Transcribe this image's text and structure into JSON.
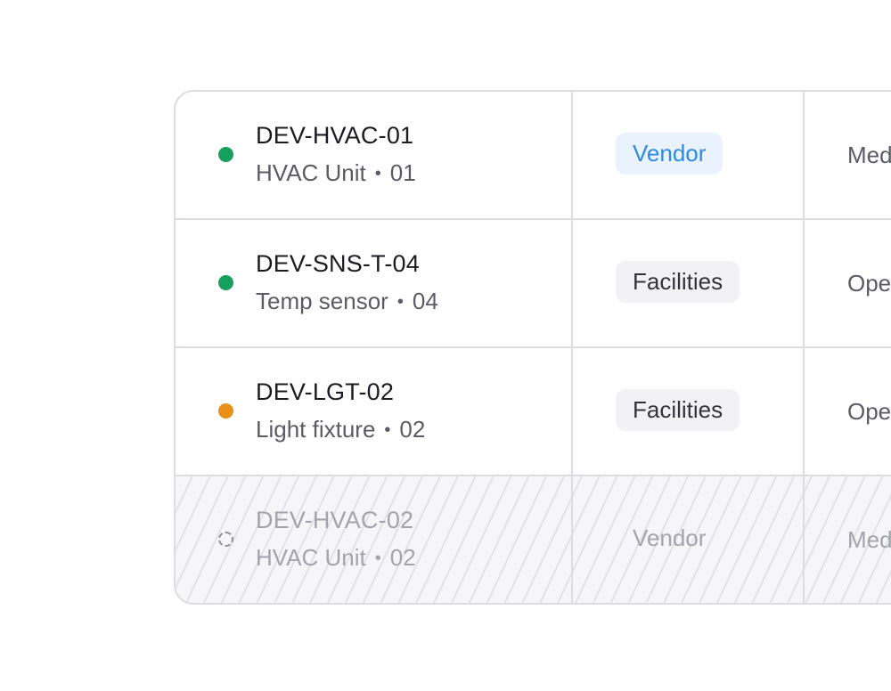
{
  "rows": [
    {
      "id": "DEV-HVAC-01",
      "type": "HVAC Unit",
      "number": "01",
      "status": "online",
      "team": "Vendor",
      "priority": "Medium"
    },
    {
      "id": "DEV-SNS-T-04",
      "type": "Temp sensor",
      "number": "04",
      "status": "online",
      "team": "Facilities",
      "priority": "Open"
    },
    {
      "id": "DEV-LGT-02",
      "type": "Light fixture",
      "number": "02",
      "status": "warning",
      "team": "Facilities",
      "priority": "Open"
    },
    {
      "id": "DEV-HVAC-02",
      "type": "HVAC Unit",
      "number": "02",
      "status": "offline",
      "team": "Vendor",
      "priority": "Medium"
    }
  ],
  "separator": "•",
  "colors": {
    "online": "#16a05d",
    "warning": "#e98e17",
    "vendor_chip_text": "#2d8ae6",
    "vendor_chip_bg": "#eaf3fd",
    "facilities_chip_bg": "#f2f2f5",
    "border": "#dcdce2"
  }
}
